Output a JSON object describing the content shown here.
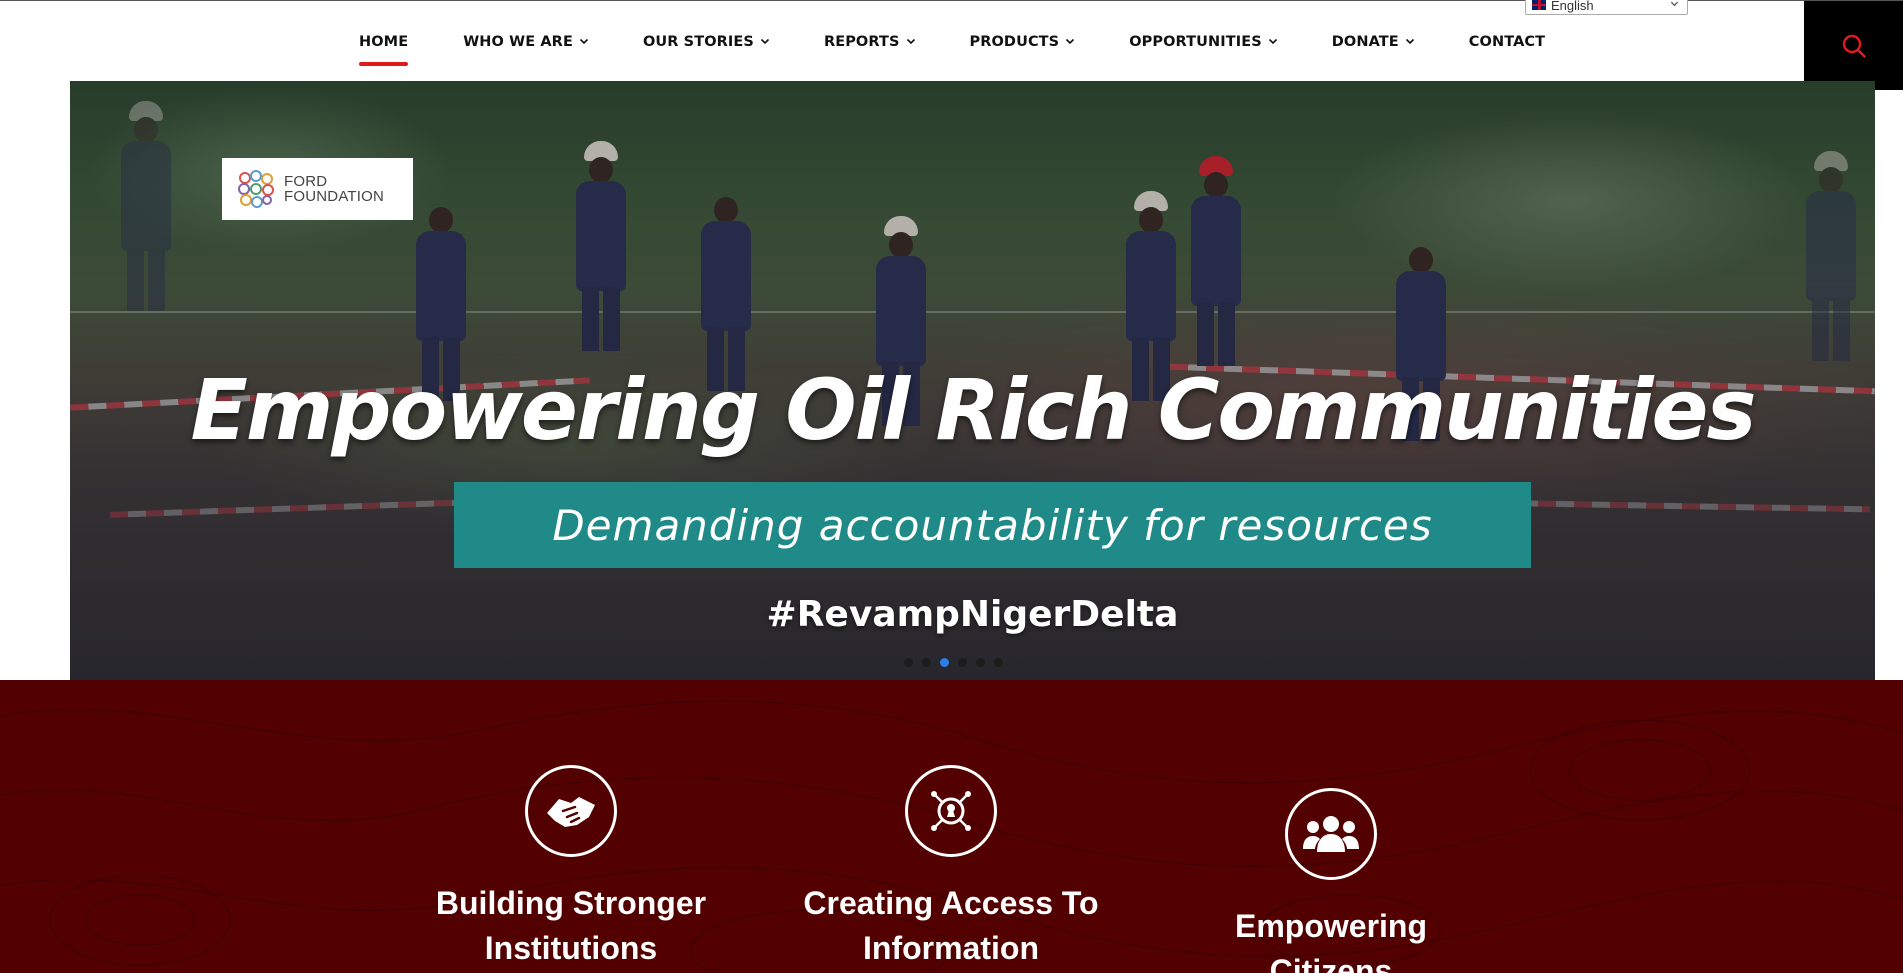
{
  "nav": {
    "items": [
      {
        "label": "HOME",
        "active": true,
        "dropdown": false
      },
      {
        "label": "WHO WE ARE",
        "dropdown": true
      },
      {
        "label": "OUR STORIES",
        "dropdown": true
      },
      {
        "label": "REPORTS",
        "dropdown": true
      },
      {
        "label": "PRODUCTS",
        "dropdown": true
      },
      {
        "label": "OPPORTUNITIES",
        "dropdown": true
      },
      {
        "label": "DONATE",
        "dropdown": true
      },
      {
        "label": "CONTACT",
        "dropdown": false
      }
    ],
    "language": "English",
    "search_icon": "search-icon",
    "accent_color": "#e11b1b"
  },
  "hero": {
    "logo_text_line1": "FORD",
    "logo_text_line2": "FOUNDATION",
    "title": "Empowering Oil Rich Communities",
    "banner": "Demanding accountability for resources",
    "hashtag": "#RevampNigerDelta",
    "banner_color": "#1f8a88",
    "slide_count": 6,
    "active_slide": 3
  },
  "features": {
    "background_color": "#520000",
    "items": [
      {
        "title_line1": "Building Stronger",
        "title_line2": "Institutions",
        "icon": "handshake-icon"
      },
      {
        "title_line1": "Creating Access To",
        "title_line2": "Information",
        "icon": "keyhole-network-icon"
      },
      {
        "title_line1": "Empowering Citizens",
        "title_line2": "",
        "icon": "people-group-icon"
      }
    ]
  }
}
